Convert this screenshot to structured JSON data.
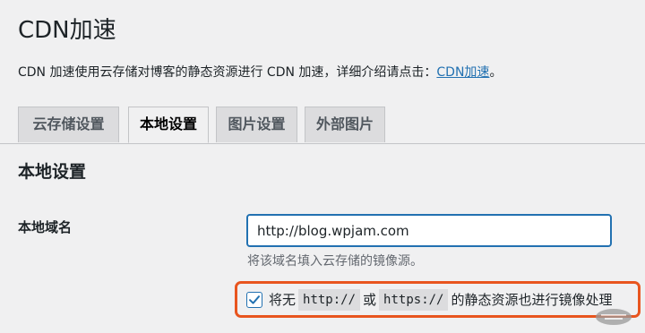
{
  "page": {
    "title": "CDN加速",
    "intro_text": "CDN 加速使用云存储对博客的静态资源进行 CDN 加速，详细介绍请点击：",
    "intro_link": "CDN加速",
    "intro_end": "。"
  },
  "tabs": [
    {
      "label": "云存储设置",
      "active": false
    },
    {
      "label": "本地设置",
      "active": true
    },
    {
      "label": "图片设置",
      "active": false
    },
    {
      "label": "外部图片",
      "active": false
    }
  ],
  "section": {
    "title": "本地设置",
    "domain_label": "本地域名",
    "domain_value": "http://blog.wpjam.com",
    "domain_description": "将该域名填入云存储的镜像源。",
    "mirror_checkbox": {
      "checked": true,
      "text_before": "将无",
      "code1": "http://",
      "text_middle": "或",
      "code2": "https://",
      "text_after": "的静态资源也进行镜像处理"
    }
  },
  "colors": {
    "accent": "#2271b1",
    "highlight": "#e8551f",
    "background": "#f0f0f1"
  },
  "icons": {
    "checkbox": "checkmark-icon",
    "watermark": "watermark-logo"
  }
}
